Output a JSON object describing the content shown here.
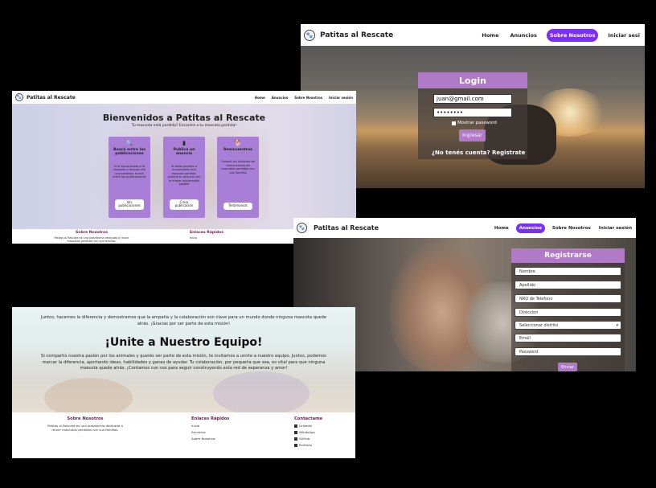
{
  "brand": "Patitas al Rescate",
  "colors": {
    "purple": "#b07ac9",
    "violet": "#7b2ff7",
    "card": "#a87ed6",
    "footer_title": "#7b1450"
  },
  "login_page": {
    "nav": [
      "Home",
      "Anuncios",
      "Sobre Nosotros",
      "Iniciar sesi"
    ],
    "active": "Sobre Nosotros",
    "title": "Login",
    "email_value": "juan@gmail.com",
    "password_value": "••••••••",
    "show_password": "Mostrar password",
    "submit": "Ingresar",
    "register_prompt": "¿No tenés cuenta?",
    "register_link": "Registrate"
  },
  "home_page": {
    "nav": [
      "Home",
      "Anuncios",
      "Sobre Nosotros",
      "Iniciar sesión"
    ],
    "title": "Bienvenidos a Patitas al Rescate",
    "subtitle": "Tu mascota está perdida? Encontrá a tu mascota perdida!",
    "cards": [
      {
        "icon": "search-icon",
        "title": "Buscá entre las publicaciones",
        "text": "Si te encontraste a tu mascota o buscás una que perdiste, buscá entre las publicaciones",
        "button": "Ver publicaciones"
      },
      {
        "icon": "document-icon",
        "title": "Publicá un anuncio",
        "text": "Si estás perdido o encontraste una mascota perdida, publicá tu anuncio con la mayor información posible",
        "button": "Crear publicación"
      },
      {
        "icon": "dog-icon",
        "title": "Reencuentros",
        "text": "Conocé los historias de reencuentros de mascotas perdidas con sus familias",
        "button": "Testimonios"
      }
    ],
    "footer": {
      "about_title": "Sobre Nosotros",
      "about_text": "Patitas al Rescate es una plataforma dedicada a reunir mascotas perdidas con sus familias.",
      "links_title": "Enlaces Rápidos",
      "links_first": "Inicio"
    }
  },
  "register_page": {
    "nav": [
      "Home",
      "Anuncios",
      "Sobre Nosotros",
      "Iniciar sesión"
    ],
    "active": "Anuncios",
    "title": "Registrarse",
    "fields": [
      "Nombre",
      "Apellido",
      "NRO de Telefono",
      "Direccion"
    ],
    "select": "Seleccionar distrito",
    "fields2": [
      "Email",
      "Password"
    ],
    "submit": "Enviar"
  },
  "about_page": {
    "p1": "Juntos, hacemos la diferencia y demostramos que la empatía y la colaboración son clave para un mundo donde ninguna mascota quede atrás. ¡Gracias por ser parte de esta misión!",
    "title": "¡Unite a Nuestro Equipo!",
    "p2": "Si compartís nuestra pasión por los animales y querés ser parte de esta misión, te invitamos a unirte a nuestro equipo. Juntos, podemos marcar la diferencia, aportando ideas, habilidades y ganas de ayudar. Tu colaboración, por pequeña que sea, es vital para que ninguna mascota quede atrás. ¡Contamos con vos para seguir construyendo esta red de esperanza y amor!",
    "footer": {
      "about_title": "Sobre Nosotros",
      "about_text": "Patitas al Rescate es una plataforma dedicada a reunir mascotas perdidas con sus familias.",
      "links_title": "Enlaces Rápidos",
      "links": [
        "Inicio",
        "Anuncios",
        "Sobre Nosotros"
      ],
      "contact_title": "Contactame",
      "contacts": [
        "LinkedIn",
        "WhatsApp",
        "GitHub",
        "Portfolio"
      ]
    }
  }
}
